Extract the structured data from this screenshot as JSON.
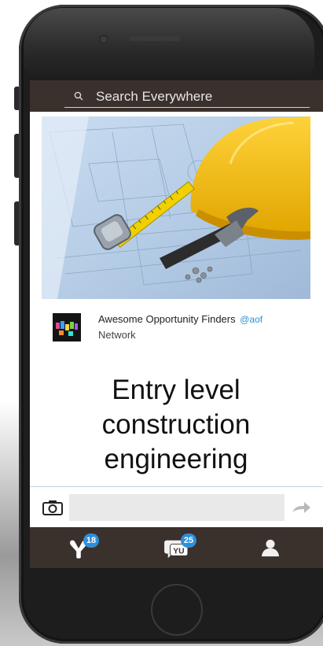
{
  "search": {
    "label": "Search Everywhere"
  },
  "post": {
    "hero_alt": "construction blueprint with hard hat, tape measure and hammer",
    "author_name": "Awesome Opportunity Finders",
    "author_handle": "@aof",
    "author_network": "Network",
    "headline_lines": [
      "Entry level",
      "construction",
      "engineering"
    ]
  },
  "compose": {
    "placeholder": ""
  },
  "tabs": [
    {
      "icon": "yammer-logo-icon",
      "badge": "18"
    },
    {
      "icon": "yu-chat-icon",
      "badge": "25"
    },
    {
      "icon": "user-profile-icon"
    }
  ],
  "colors": {
    "accent": "#2d8fd8",
    "bar": "#3a302c",
    "headline": "#111111"
  }
}
